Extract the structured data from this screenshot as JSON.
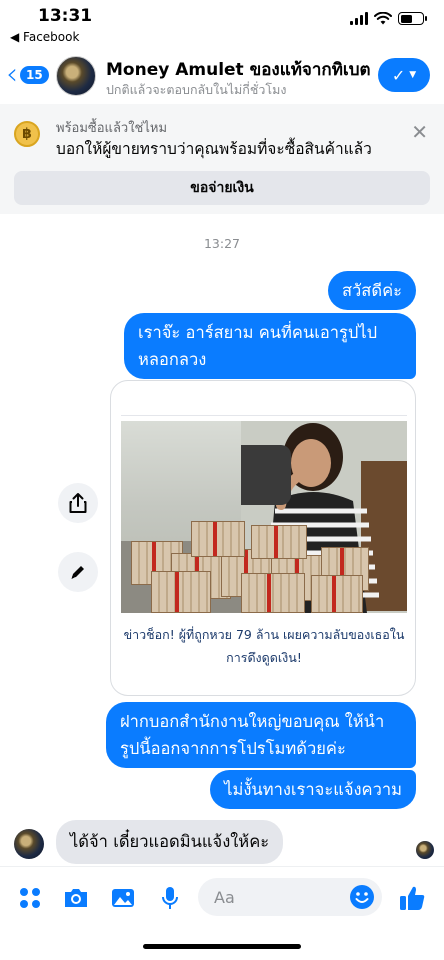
{
  "status": {
    "time": "13:31",
    "back_app": "◀ Facebook",
    "battery_level": 0.55
  },
  "header": {
    "back_count": "15",
    "title": "Money Amulet ของแท้จากทิเบต",
    "subtitle": "ปกติแล้วจะตอบกลับในไม่กี่ชั่วโมง",
    "action_icon": "check-icon"
  },
  "promo": {
    "coin_symbol": "฿",
    "title": "พร้อมซื้อแล้วใช่ไหม",
    "body": "บอกให้ผู้ขายทราบว่าคุณพร้อมที่จะซื้อสินค้าแล้ว",
    "pay_button": "ขอจ่ายเงิน",
    "close": "✕"
  },
  "conversation": {
    "timestamp": "13:27",
    "outgoing_1": "สวัสดีค่ะ",
    "outgoing_2": "เราจ๊ะ อาร์สยาม คนที่คนเอารูปไปหลอกลวง",
    "shared_link": {
      "caption": "ข่าวช็อก! ผู้ที่ถูกหวย 79 ล้าน เผยความลับของเธอในการดึงดูดเงิน!"
    },
    "outgoing_3": "ฝากบอกสำนักงานใหญ่ขอบคุณ ให้นำรูปนี้ออกจากการโปรโมทด้วยค่ะ",
    "outgoing_4": "ไม่งั้นทางเราจะแจ้งความ",
    "incoming_1": "ได้จ้า เดี๋ยวแอดมินแจ้งให้คะ"
  },
  "composer": {
    "placeholder": "Aa"
  },
  "colors": {
    "accent": "#0a7cff",
    "incoming_bubble": "#e4e6eb"
  }
}
